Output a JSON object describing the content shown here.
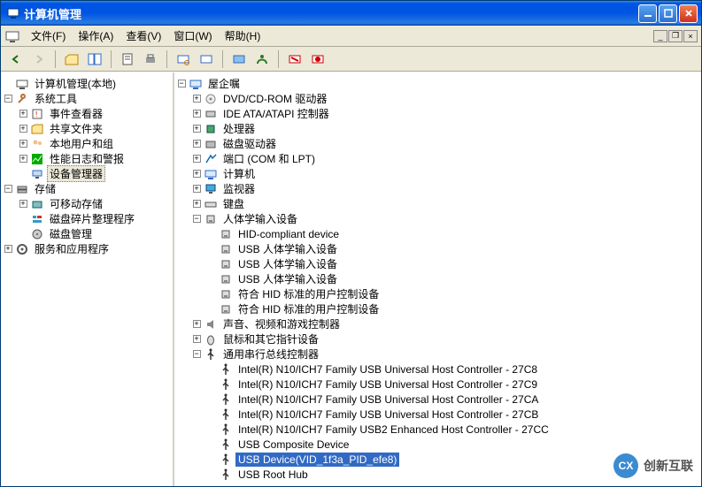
{
  "window": {
    "title": "计算机管理"
  },
  "menu": {
    "file": "文件(F)",
    "action": "操作(A)",
    "view": "查看(V)",
    "window": "窗口(W)",
    "help": "帮助(H)"
  },
  "left_tree": {
    "root": "计算机管理(本地)",
    "system_tools": "系统工具",
    "event_viewer": "事件查看器",
    "shared_folders": "共享文件夹",
    "local_users": "本地用户和组",
    "perf_logs": "性能日志和警报",
    "device_mgr": "设备管理器",
    "storage": "存储",
    "removable": "可移动存储",
    "defrag": "磁盘碎片整理程序",
    "disk_mgmt": "磁盘管理",
    "services_apps": "服务和应用程序"
  },
  "right_tree": {
    "root": "屋企嘱",
    "dvd": "DVD/CD-ROM 驱动器",
    "ide": "IDE ATA/ATAPI 控制器",
    "cpu": "处理器",
    "disk": "磁盘驱动器",
    "ports": "端口 (COM 和 LPT)",
    "computer": "计算机",
    "monitor": "监视器",
    "keyboard": "键盘",
    "hid_header": "人体学输入设备",
    "hid_items": [
      "HID-compliant device",
      "USB 人体学输入设备",
      "USB 人体学输入设备",
      "USB 人体学输入设备",
      "符合 HID 标准的用户控制设备",
      "符合 HID 标准的用户控制设备"
    ],
    "sound": "声音、视频和游戏控制器",
    "mouse": "鼠标和其它指针设备",
    "usb_header": "通用串行总线控制器",
    "usb_items": [
      "Intel(R) N10/ICH7 Family USB Universal Host Controller - 27C8",
      "Intel(R) N10/ICH7 Family USB Universal Host Controller - 27C9",
      "Intel(R) N10/ICH7 Family USB Universal Host Controller - 27CA",
      "Intel(R) N10/ICH7 Family USB Universal Host Controller - 27CB",
      "Intel(R) N10/ICH7 Family USB2 Enhanced Host Controller - 27CC",
      "USB Composite Device",
      "USB Device(VID_1f3a_PID_efe8)",
      "USB Root Hub"
    ],
    "usb_selected_index": 6
  },
  "watermark": {
    "text": "创新互联"
  }
}
